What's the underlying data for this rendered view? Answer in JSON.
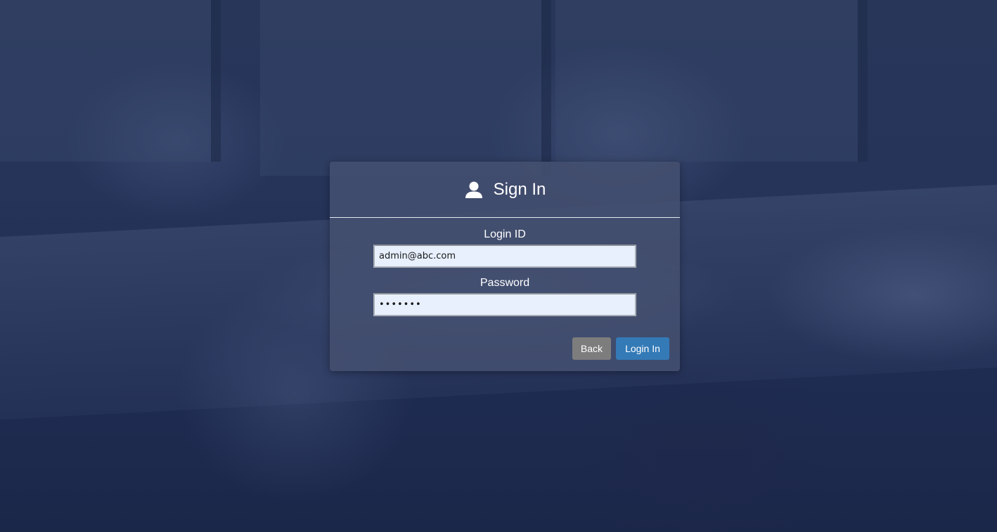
{
  "login": {
    "title": "Sign In",
    "icon": "user-icon",
    "login_id_label": "Login ID",
    "login_id_value": "admin@abc.com",
    "password_label": "Password",
    "password_value": "•••••••",
    "back_label": "Back",
    "submit_label": "Login In"
  },
  "colors": {
    "background_overlay": "#26345a",
    "panel": "#445070",
    "input_background": "#e8f0fe",
    "back_button": "#7d7d7d",
    "primary_button": "#337ab7"
  }
}
